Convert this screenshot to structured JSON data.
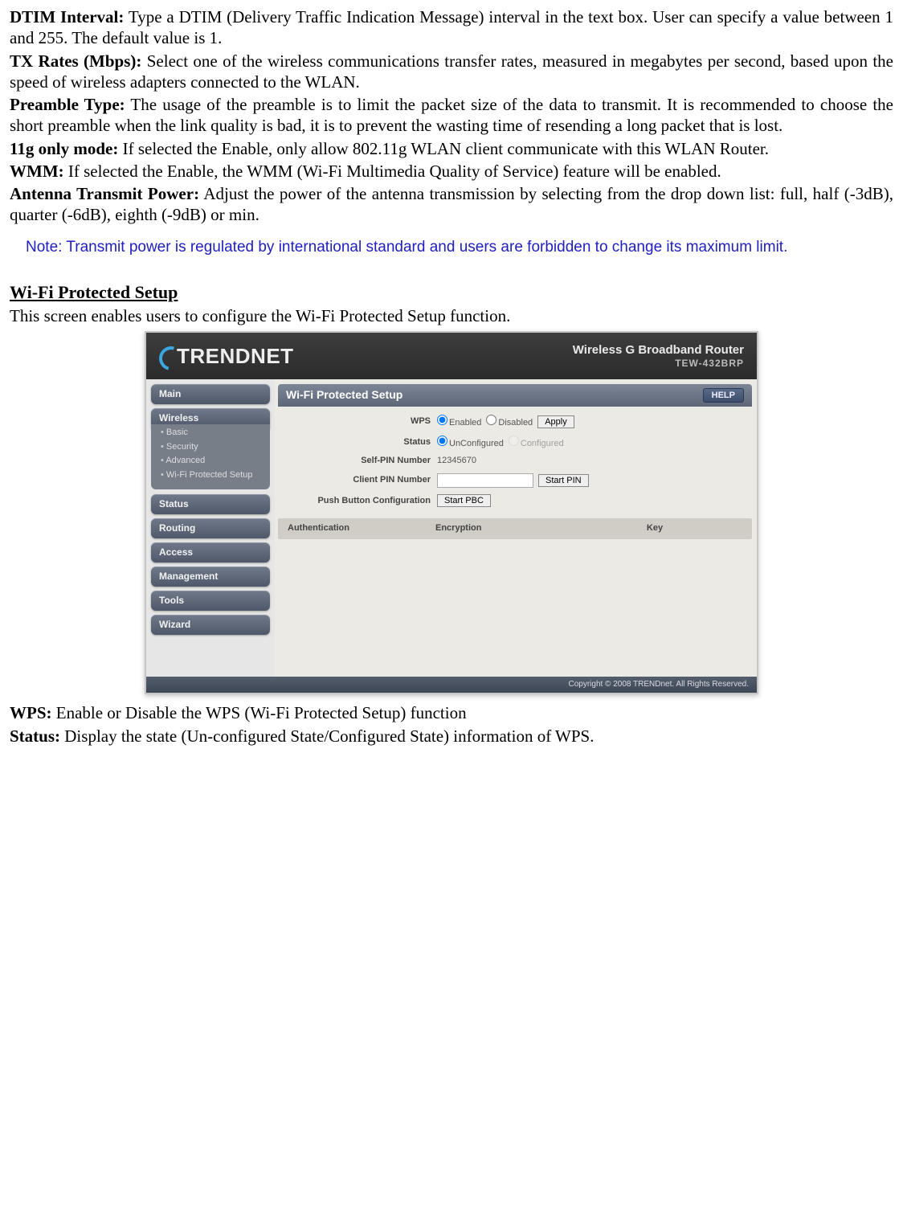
{
  "para1": {
    "label": "DTIM Interval:",
    "text": " Type a DTIM (Delivery Traffic Indication Message) interval in the text box. User can specify a value between 1 and 255. The default value is 1."
  },
  "para2": {
    "label": "TX Rates (Mbps):",
    "text": " Select one of the wireless communications transfer rates, measured in megabytes per second, based upon the speed of wireless adapters connected to the WLAN."
  },
  "para3": {
    "label": "Preamble Type:",
    "text": " The usage of the preamble is to limit the packet size of the data to transmit. It is recommended to choose the short preamble when the link quality is bad, it is to prevent the wasting time of resending a long packet that is lost."
  },
  "para4": {
    "label": "11g only mode:",
    "text": " If selected the Enable, only allow 802.11g WLAN client communicate with this WLAN Router."
  },
  "para5": {
    "label": "WMM:",
    "text": " If selected the Enable, the WMM (Wi-Fi Multimedia Quality of Service) feature will be enabled."
  },
  "para6": {
    "label": "Antenna Transmit Power:",
    "text": " Adjust the power of the antenna transmission by selecting from the drop down list: full, half (-3dB), quarter (-6dB), eighth (-9dB) or min."
  },
  "note": "Note: Transmit power is regulated by international standard and users are forbidden to change its maximum limit.",
  "section_heading": "Wi-Fi Protected Setup",
  "section_intro": "This screen enables users to configure the Wi-Fi Protected Setup function.",
  "para7": {
    "label": "WPS:",
    "text": " Enable or Disable the WPS (Wi-Fi Protected Setup) function"
  },
  "para8": {
    "label": "Status:",
    "text": " Display the state (Un-configured State/Configured State) information of WPS."
  },
  "router": {
    "brand_main": "TRENDNET",
    "title_line1": "Wireless G Broadband Router",
    "title_line2": "TEW-432BRP",
    "sidebar": {
      "main": "Main",
      "wireless": "Wireless",
      "sub_basic": "Basic",
      "sub_security": "Security",
      "sub_advanced": "Advanced",
      "sub_wps": "Wi-Fi Protected Setup",
      "status": "Status",
      "routing": "Routing",
      "access": "Access",
      "management": "Management",
      "tools": "Tools",
      "wizard": "Wizard"
    },
    "panel_title": "Wi-Fi Protected Setup",
    "help": "HELP",
    "rows": {
      "wps_label": "WPS",
      "wps_enabled": "Enabled",
      "wps_disabled": "Disabled",
      "apply": "Apply",
      "status_label": "Status",
      "status_unconfig": "UnConfigured",
      "status_config": "Configured",
      "selfpin_label": "Self-PIN Number",
      "selfpin_value": "12345670",
      "clientpin_label": "Client PIN Number",
      "clientpin_value": "",
      "startpin": "Start PIN",
      "pbc_label": "Push Button Configuration",
      "startpbc": "Start PBC"
    },
    "table": {
      "auth": "Authentication",
      "enc": "Encryption",
      "key": "Key"
    },
    "footer": "Copyright © 2008 TRENDnet. All Rights Reserved."
  }
}
